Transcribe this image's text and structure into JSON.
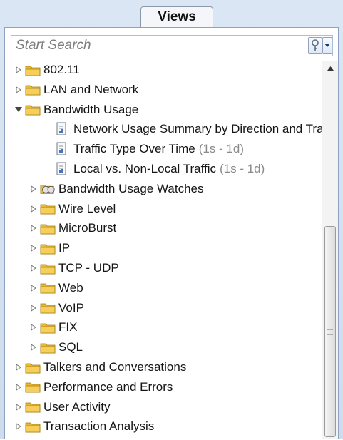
{
  "panel": {
    "tab_label": "Views"
  },
  "search": {
    "placeholder": "Start Search"
  },
  "tree": [
    {
      "label": "802.11",
      "suffix": "",
      "level": 0,
      "type": "folder",
      "expanded": false
    },
    {
      "label": "LAN and Network",
      "suffix": "",
      "level": 0,
      "type": "folder",
      "expanded": false
    },
    {
      "label": "Bandwidth Usage",
      "suffix": "",
      "level": 0,
      "type": "folder",
      "expanded": true
    },
    {
      "label": "Network Usage Summary by Direction and Traffi",
      "suffix": "",
      "level": 2,
      "type": "view"
    },
    {
      "label": "Traffic Type Over Time",
      "suffix": "(1s - 1d)",
      "level": 2,
      "type": "view"
    },
    {
      "label": "Local vs. Non-Local Traffic",
      "suffix": "(1s - 1d)",
      "level": 2,
      "type": "view"
    },
    {
      "label": "Bandwidth Usage Watches",
      "suffix": "",
      "level": 1,
      "type": "watch-folder",
      "expanded": false
    },
    {
      "label": "Wire Level",
      "suffix": "",
      "level": 1,
      "type": "folder",
      "expanded": false
    },
    {
      "label": "MicroBurst",
      "suffix": "",
      "level": 1,
      "type": "folder",
      "expanded": false
    },
    {
      "label": "IP",
      "suffix": "",
      "level": 1,
      "type": "folder",
      "expanded": false
    },
    {
      "label": "TCP - UDP",
      "suffix": "",
      "level": 1,
      "type": "folder",
      "expanded": false
    },
    {
      "label": "Web",
      "suffix": "",
      "level": 1,
      "type": "folder",
      "expanded": false
    },
    {
      "label": "VoIP",
      "suffix": "",
      "level": 1,
      "type": "folder",
      "expanded": false
    },
    {
      "label": "FIX",
      "suffix": "",
      "level": 1,
      "type": "folder",
      "expanded": false
    },
    {
      "label": "SQL",
      "suffix": "",
      "level": 1,
      "type": "folder",
      "expanded": false
    },
    {
      "label": "Talkers and Conversations",
      "suffix": "",
      "level": 0,
      "type": "folder",
      "expanded": false
    },
    {
      "label": "Performance and Errors",
      "suffix": "",
      "level": 0,
      "type": "folder",
      "expanded": false
    },
    {
      "label": "User Activity",
      "suffix": "",
      "level": 0,
      "type": "folder",
      "expanded": false
    },
    {
      "label": "Transaction Analysis",
      "suffix": "",
      "level": 0,
      "type": "folder",
      "expanded": false
    }
  ],
  "icons": {
    "search_options": "key-icon",
    "search_dropdown": "dropdown-arrow-icon",
    "folder": "folder-icon",
    "view": "report-view-icon",
    "watch_folder": "watch-folder-icon"
  },
  "colors": {
    "folder": "#e8b830",
    "panel_bg": "#d6e2f2",
    "muted_text": "#8a8a8a"
  }
}
